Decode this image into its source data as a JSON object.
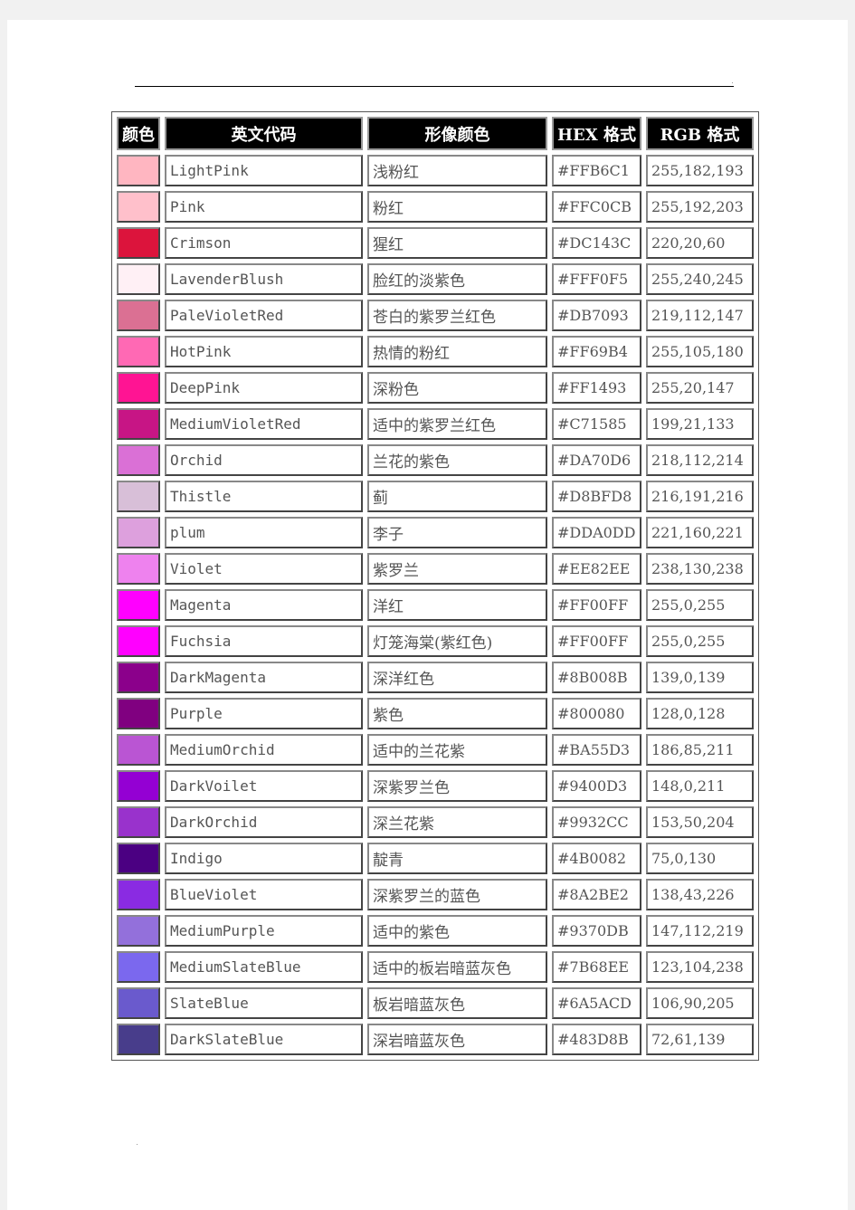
{
  "headers": [
    "颜色",
    "英文代码",
    "形像颜色",
    "HEX 格式",
    "RGB 格式"
  ],
  "rows": [
    [
      "LightPink",
      "浅粉红",
      "#FFB6C1",
      "255,182,193"
    ],
    [
      "Pink",
      "粉红",
      "#FFC0CB",
      "255,192,203"
    ],
    [
      "Crimson",
      "猩红",
      "#DC143C",
      "220,20,60"
    ],
    [
      "LavenderBlush",
      "脸红的淡紫色",
      "#FFF0F5",
      "255,240,245"
    ],
    [
      "PaleVioletRed",
      "苍白的紫罗兰红色",
      "#DB7093",
      "219,112,147"
    ],
    [
      "HotPink",
      "热情的粉红",
      "#FF69B4",
      "255,105,180"
    ],
    [
      "DeepPink",
      "深粉色",
      "#FF1493",
      "255,20,147"
    ],
    [
      "MediumVioletRed",
      "适中的紫罗兰红色",
      "#C71585",
      "199,21,133"
    ],
    [
      "Orchid",
      "兰花的紫色",
      "#DA70D6",
      "218,112,214"
    ],
    [
      "Thistle",
      "蓟",
      "#D8BFD8",
      "216,191,216"
    ],
    [
      "plum",
      "李子",
      "#DDA0DD",
      "221,160,221"
    ],
    [
      "Violet",
      "紫罗兰",
      "#EE82EE",
      "238,130,238"
    ],
    [
      "Magenta",
      "洋红",
      "#FF00FF",
      "255,0,255"
    ],
    [
      "Fuchsia",
      "灯笼海棠(紫红色)",
      "#FF00FF",
      "255,0,255"
    ],
    [
      "DarkMagenta",
      "深洋红色",
      "#8B008B",
      "139,0,139"
    ],
    [
      "Purple",
      "紫色",
      "#800080",
      "128,0,128"
    ],
    [
      "MediumOrchid",
      "适中的兰花紫",
      "#BA55D3",
      "186,85,211"
    ],
    [
      "DarkVoilet",
      "深紫罗兰色",
      "#9400D3",
      "148,0,211"
    ],
    [
      "DarkOrchid",
      "深兰花紫",
      "#9932CC",
      "153,50,204"
    ],
    [
      "Indigo",
      "靛青",
      "#4B0082",
      "75,0,130"
    ],
    [
      "BlueViolet",
      "深紫罗兰的蓝色",
      "#8A2BE2",
      "138,43,226"
    ],
    [
      "MediumPurple",
      "适中的紫色",
      "#9370DB",
      "147,112,219"
    ],
    [
      "MediumSlateBlue",
      "适中的板岩暗蓝灰色",
      "#7B68EE",
      "123,104,238"
    ],
    [
      "SlateBlue",
      "板岩暗蓝灰色",
      "#6A5ACD",
      "106,90,205"
    ],
    [
      "DarkSlateBlue",
      "深岩暗蓝灰色",
      "#483D8B",
      "72,61,139"
    ]
  ]
}
